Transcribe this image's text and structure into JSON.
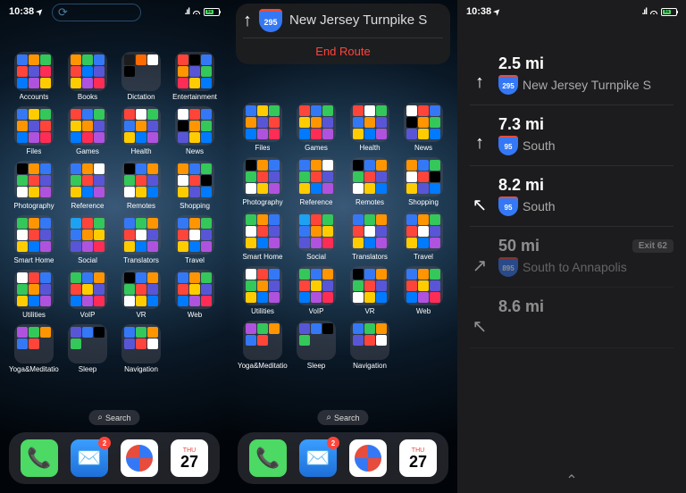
{
  "status": {
    "time": "10:38",
    "battery": "51"
  },
  "banner": {
    "shield": "295",
    "road": "New Jersey Turnpike S",
    "end": "End Route"
  },
  "folders": [
    {
      "label": "Accounts",
      "c": [
        "#3478f6",
        "#ff9500",
        "#34c759",
        "#ff453a",
        "#5856d6",
        "#ff2d55",
        "#007aff",
        "#af52de",
        "#ffcc00"
      ]
    },
    {
      "label": "Books",
      "c": [
        "#ff9500",
        "#34c759",
        "#3478f6",
        "#ff453a",
        "#007aff",
        "#5856d6",
        "#ffcc00",
        "#af52de",
        "#ff2d55"
      ]
    },
    {
      "label": "Dictation",
      "c": [
        "#1c1c1e",
        "#ff6b00",
        "#fff",
        "#000",
        "",
        "",
        "",
        "",
        ""
      ]
    },
    {
      "label": "Entertainment",
      "c": [
        "#ff453a",
        "#000",
        "#3478f6",
        "#ff9500",
        "#5856d6",
        "#34c759",
        "#ff2d55",
        "#ffcc00",
        "#007aff"
      ]
    },
    {
      "label": "Files",
      "c": [
        "#3478f6",
        "#ffcc00",
        "#34c759",
        "#ff9500",
        "#5856d6",
        "#ff453a",
        "#007aff",
        "#af52de",
        "#ff2d55"
      ]
    },
    {
      "label": "Games",
      "c": [
        "#ff453a",
        "#3478f6",
        "#34c759",
        "#ffcc00",
        "#ff9500",
        "#5856d6",
        "#007aff",
        "#ff2d55",
        "#af52de"
      ]
    },
    {
      "label": "Health",
      "c": [
        "#ff453a",
        "#fff",
        "#34c759",
        "#3478f6",
        "#ff9500",
        "#5856d6",
        "#ffcc00",
        "#007aff",
        "#af52de"
      ]
    },
    {
      "label": "News",
      "c": [
        "#fff",
        "#ff453a",
        "#3478f6",
        "#000",
        "#ff9500",
        "#34c759",
        "#5856d6",
        "#ffcc00",
        "#007aff"
      ]
    },
    {
      "label": "Photography",
      "c": [
        "#000",
        "#ff9500",
        "#3478f6",
        "#34c759",
        "#ff453a",
        "#5856d6",
        "#fff",
        "#ffcc00",
        "#af52de"
      ]
    },
    {
      "label": "Reference",
      "c": [
        "#3478f6",
        "#ff9500",
        "#fff",
        "#34c759",
        "#ff453a",
        "#5856d6",
        "#ffcc00",
        "#007aff",
        "#af52de"
      ]
    },
    {
      "label": "Remotes",
      "c": [
        "#000",
        "#3478f6",
        "#ff9500",
        "#34c759",
        "#ff453a",
        "#5856d6",
        "#fff",
        "#ffcc00",
        "#007aff"
      ]
    },
    {
      "label": "Shopping",
      "c": [
        "#ff9500",
        "#3478f6",
        "#34c759",
        "#fff",
        "#ff453a",
        "#000",
        "#ffcc00",
        "#5856d6",
        "#007aff"
      ]
    },
    {
      "label": "Smart Home",
      "c": [
        "#34c759",
        "#ff9500",
        "#3478f6",
        "#fff",
        "#ff453a",
        "#5856d6",
        "#ffcc00",
        "#007aff",
        "#af52de"
      ]
    },
    {
      "label": "Social",
      "c": [
        "#1da1f2",
        "#ff453a",
        "#34c759",
        "#3478f6",
        "#ff9500",
        "#ffcc00",
        "#5856d6",
        "#af52de",
        "#ff2d55"
      ]
    },
    {
      "label": "Translators",
      "c": [
        "#3478f6",
        "#34c759",
        "#ff9500",
        "#ff453a",
        "#fff",
        "#5856d6",
        "#ffcc00",
        "#007aff",
        "#af52de"
      ]
    },
    {
      "label": "Travel",
      "c": [
        "#3478f6",
        "#ff9500",
        "#34c759",
        "#ff453a",
        "#fff",
        "#5856d6",
        "#ffcc00",
        "#007aff",
        "#af52de"
      ]
    },
    {
      "label": "Utilities",
      "c": [
        "#fff",
        "#ff453a",
        "#3478f6",
        "#34c759",
        "#ff9500",
        "#5856d6",
        "#ffcc00",
        "#007aff",
        "#af52de"
      ]
    },
    {
      "label": "VoIP",
      "c": [
        "#34c759",
        "#3478f6",
        "#ff9500",
        "#ff453a",
        "#ffcc00",
        "#5856d6",
        "#007aff",
        "#af52de",
        "#ff2d55"
      ]
    },
    {
      "label": "VR",
      "c": [
        "#000",
        "#3478f6",
        "#ff9500",
        "#34c759",
        "#ff453a",
        "#5856d6",
        "#fff",
        "#ffcc00",
        "#007aff"
      ]
    },
    {
      "label": "Web",
      "c": [
        "#3478f6",
        "#ff9500",
        "#34c759",
        "#ff453a",
        "#ffcc00",
        "#5856d6",
        "#007aff",
        "#af52de",
        "#ff2d55"
      ]
    },
    {
      "label": "Yoga&Meditation",
      "c": [
        "#af52de",
        "#34c759",
        "#ff9500",
        "#3478f6",
        "#ff453a",
        "",
        "",
        "",
        ""
      ]
    },
    {
      "label": "Sleep",
      "c": [
        "#5856d6",
        "#3478f6",
        "#000",
        "#34c759",
        "",
        "",
        "",
        "",
        ""
      ]
    },
    {
      "label": "Navigation",
      "c": [
        "#3478f6",
        "#34c759",
        "#ff9500",
        "#5856d6",
        "#ff453a",
        "#fff",
        "",
        "",
        ""
      ]
    }
  ],
  "search": "Search",
  "dock": {
    "mail_badge": "2",
    "cal_day": "THU",
    "cal_num": "27"
  },
  "directions": [
    {
      "dist": "2.5 mi",
      "icon": "↑",
      "shield": "295",
      "label": "New Jersey Turnpike S",
      "dim": false
    },
    {
      "dist": "7.3 mi",
      "icon": "↑",
      "shield": "95",
      "label": "South",
      "dim": false
    },
    {
      "dist": "8.2 mi",
      "icon": "↖",
      "shield": "95",
      "label": "South",
      "dim": false
    },
    {
      "dist": "50 mi",
      "icon": "↗",
      "shield": "895",
      "label": "South to Annapolis",
      "exit": "Exit 62",
      "dim": true
    },
    {
      "dist": "8.6 mi",
      "icon": "↖",
      "shield": "",
      "label": "",
      "dim": true
    }
  ]
}
